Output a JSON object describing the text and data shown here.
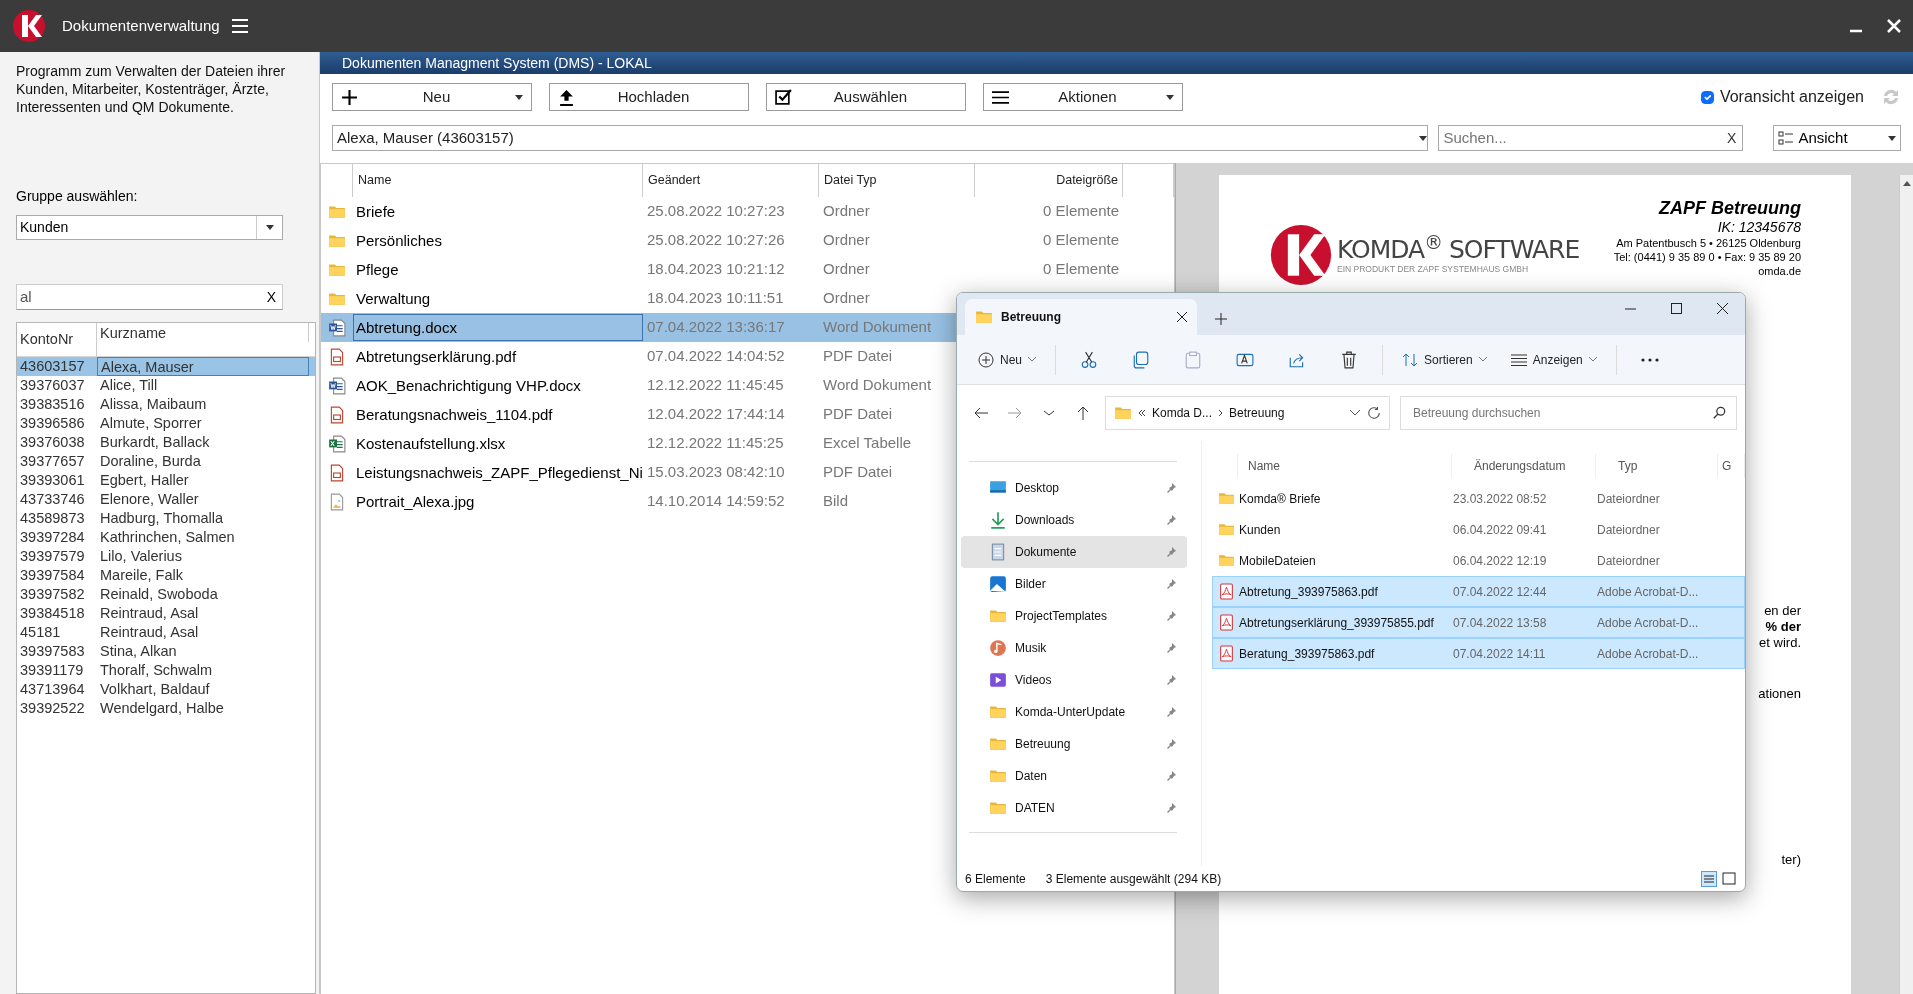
{
  "app": {
    "title": "Dokumentenverwaltung"
  },
  "sidebar": {
    "description": "Programm zum Verwalten der Dateien ihrer Kunden, Mitarbeiter, Kostenträger, Ärzte, Interessenten und QM Dokumente.",
    "group_label": "Gruppe auswählen:",
    "group_value": "Kunden",
    "filter_value": "al",
    "filter_clear": "X",
    "table": {
      "columns": [
        "KontoNr",
        "Kurzname"
      ],
      "rows": [
        {
          "konto": "43603157",
          "name": "Alexa, Mauser",
          "selected": true
        },
        {
          "konto": "39376037",
          "name": "Alice, Till",
          "selected": false
        },
        {
          "konto": "39383516",
          "name": "Alissa, Maibaum",
          "selected": false
        },
        {
          "konto": "39396586",
          "name": "Almute, Sporrer",
          "selected": false
        },
        {
          "konto": "39376038",
          "name": "Burkardt, Ballack",
          "selected": false
        },
        {
          "konto": "39377657",
          "name": "Doraline, Burda",
          "selected": false
        },
        {
          "konto": "39393061",
          "name": "Egbert, Haller",
          "selected": false
        },
        {
          "konto": "43733746",
          "name": "Elenore, Waller",
          "selected": false
        },
        {
          "konto": "43589873",
          "name": "Hadburg, Thomalla",
          "selected": false
        },
        {
          "konto": "39397284",
          "name": "Kathrinchen, Salmen",
          "selected": false
        },
        {
          "konto": "39397579",
          "name": "Lilo, Valerius",
          "selected": false
        },
        {
          "konto": "39397584",
          "name": "Mareile, Falk",
          "selected": false
        },
        {
          "konto": "39397582",
          "name": "Reinald, Swoboda",
          "selected": false
        },
        {
          "konto": "39384518",
          "name": "Reintraud, Asal",
          "selected": false
        },
        {
          "konto": "45181",
          "name": "Reintraud, Asal",
          "selected": false
        },
        {
          "konto": "39397583",
          "name": "Stina, Alkan",
          "selected": false
        },
        {
          "konto": "39391179",
          "name": "Thoralf, Schwalm",
          "selected": false
        },
        {
          "konto": "43713964",
          "name": "Volkhart, Baldauf",
          "selected": false
        },
        {
          "konto": "39392522",
          "name": "Wendelgard, Halbe",
          "selected": false
        }
      ]
    }
  },
  "dms": {
    "title": "Dokumenten Managment System (DMS) - LOKAL",
    "toolbar": [
      {
        "label": "Neu",
        "dropdown": true
      },
      {
        "label": "Hochladen",
        "dropdown": false
      },
      {
        "label": "Auswählen",
        "dropdown": false
      },
      {
        "label": "Aktionen",
        "dropdown": true
      }
    ],
    "preview_toggle": {
      "label": "Voransicht anzeigen",
      "checked": true
    },
    "person": "Alexa, Mauser (43603157)",
    "search": {
      "placeholder": "Suchen...",
      "clear": "X"
    },
    "view": "Ansicht",
    "files": {
      "columns": [
        "Name",
        "Geändert",
        "Datei Typ",
        "Dateigröße"
      ],
      "rows": [
        {
          "kind": "folder",
          "name": "Briefe",
          "modified": "25.08.2022 10:27:23",
          "type": "Ordner",
          "size": "0 Elemente",
          "selected": false
        },
        {
          "kind": "folder",
          "name": "Persönliches",
          "modified": "25.08.2022 10:27:26",
          "type": "Ordner",
          "size": "0 Elemente",
          "selected": false
        },
        {
          "kind": "folder",
          "name": "Pflege",
          "modified": "18.04.2023 10:21:12",
          "type": "Ordner",
          "size": "0 Elemente",
          "selected": false
        },
        {
          "kind": "folder",
          "name": "Verwaltung",
          "modified": "18.04.2023 10:11:51",
          "type": "Ordner",
          "selected": false
        },
        {
          "kind": "word",
          "name": "Abtretung.docx",
          "modified": "07.04.2022 13:36:17",
          "type": "Word Dokument",
          "selected": true
        },
        {
          "kind": "pdf",
          "name": "Abtretungserklärung.pdf",
          "modified": "07.04.2022 14:04:52",
          "type": "PDF Datei",
          "selected": false
        },
        {
          "kind": "word",
          "name": "AOK_Benachrichtigung VHP.docx",
          "modified": "12.12.2022 11:45:45",
          "type": "Word Dokument",
          "selected": false
        },
        {
          "kind": "pdf",
          "name": "Beratungsnachweis_1104.pdf",
          "modified": "12.04.2022 17:44:14",
          "type": "PDF Datei",
          "selected": false
        },
        {
          "kind": "excel",
          "name": "Kostenaufstellung.xlsx",
          "modified": "12.12.2022 11:45:25",
          "type": "Excel Tabelle",
          "selected": false
        },
        {
          "kind": "pdf",
          "name": "Leistungsnachweis_ZAPF_Pflegedienst_Ni",
          "modified": "15.03.2023 08:42:10",
          "type": "PDF Datei",
          "selected": false
        },
        {
          "kind": "image",
          "name": "Portrait_Alexa.jpg",
          "modified": "14.10.2014 14:59:52",
          "type": "Bild",
          "selected": false
        }
      ]
    }
  },
  "preview": {
    "logo_name": "KOMDA$^{®}$ SOFTWARE",
    "logo_tagline": "EIN PRODUKT DER ZAPF SYSTEMHAUS GMBH",
    "company": "ZAPF Betreuung",
    "ik": "IK: 12345678",
    "address": "Am Patentbusch 5 • 26125 Oldenburg",
    "phone": "Tel: (0441) 9 35 89 0 • Fax: 9 35 89 20",
    "web_fragment": "omda.de",
    "fragments": [
      {
        "text": "en der",
        "bold": false
      },
      {
        "text": "% der",
        "bold": true
      },
      {
        "text": "et wird.",
        "bold": false
      },
      {
        "text": "ationen",
        "bold": false
      },
      {
        "text": "ter)",
        "bold": false
      }
    ]
  },
  "explorer": {
    "tab": "Betreuung",
    "toolbar": {
      "new": "Neu",
      "sort": "Sortieren",
      "view": "Anzeigen"
    },
    "address": {
      "parent": "Komda D...",
      "current": "Betreuung"
    },
    "search_placeholder": "Betreuung durchsuchen",
    "nav": [
      {
        "label": "Desktop",
        "kind": "desktop",
        "selected": false
      },
      {
        "label": "Downloads",
        "kind": "download",
        "selected": false
      },
      {
        "label": "Dokumente",
        "kind": "documents",
        "selected": true
      },
      {
        "label": "Bilder",
        "kind": "pictures",
        "selected": false
      },
      {
        "label": "ProjectTemplates",
        "kind": "folder",
        "selected": false
      },
      {
        "label": "Musik",
        "kind": "music",
        "selected": false
      },
      {
        "label": "Videos",
        "kind": "video",
        "selected": false
      },
      {
        "label": "Komda-UnterUpdate",
        "kind": "folder",
        "selected": false
      },
      {
        "label": "Betreuung",
        "kind": "folder",
        "selected": false
      },
      {
        "label": "Daten",
        "kind": "folder",
        "selected": false
      },
      {
        "label": "DATEN",
        "kind": "folder",
        "selected": false
      }
    ],
    "columns": [
      "Name",
      "Änderungsdatum",
      "Typ",
      "G"
    ],
    "rows": [
      {
        "kind": "folder",
        "name": "Komda® Briefe",
        "modified": "23.03.2022 08:52",
        "type": "Dateiordner",
        "selected": false
      },
      {
        "kind": "folder",
        "name": "Kunden",
        "modified": "06.04.2022 09:41",
        "type": "Dateiordner",
        "selected": false
      },
      {
        "kind": "folder",
        "name": "MobileDateien",
        "modified": "06.04.2022 12:19",
        "type": "Dateiordner",
        "selected": false
      },
      {
        "kind": "pdf",
        "name": "Abtretung_393975863.pdf",
        "modified": "07.04.2022 12:44",
        "type": "Adobe Acrobat-D...",
        "selected": true
      },
      {
        "kind": "pdf",
        "name": "Abtretungserklärung_393975855.pdf",
        "modified": "07.04.2022 13:58",
        "type": "Adobe Acrobat-D...",
        "selected": true
      },
      {
        "kind": "pdf",
        "name": "Beratung_393975863.pdf",
        "modified": "07.04.2022 14:11",
        "type": "Adobe Acrobat-D...",
        "selected": true
      }
    ],
    "status": {
      "count": "6 Elemente",
      "selection": "3 Elemente ausgewählt (294 KB)"
    }
  }
}
